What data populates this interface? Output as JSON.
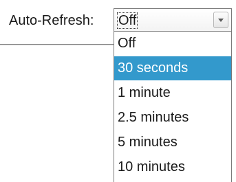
{
  "auto_refresh": {
    "label": "Auto-Refresh:",
    "selected_value": "Off",
    "highlighted_option": "30 seconds",
    "options": [
      "Off",
      "30 seconds",
      "1 minute",
      "2.5 minutes",
      "5 minutes",
      "10 minutes"
    ],
    "highlight_color": "#3399cc"
  },
  "icons": {
    "dropdown_arrow": "chevron-down-icon"
  }
}
